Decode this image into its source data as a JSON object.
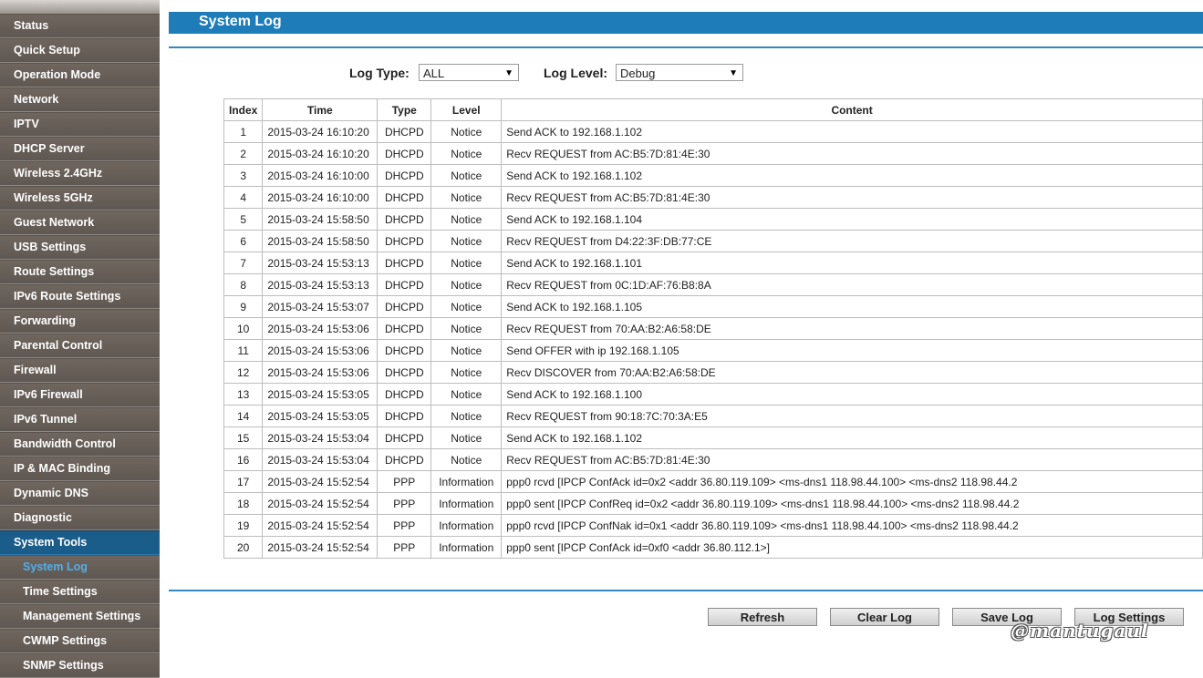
{
  "sidebar": {
    "items": [
      {
        "label": "Status"
      },
      {
        "label": "Quick Setup"
      },
      {
        "label": "Operation Mode"
      },
      {
        "label": "Network"
      },
      {
        "label": "IPTV"
      },
      {
        "label": "DHCP Server"
      },
      {
        "label": "Wireless 2.4GHz"
      },
      {
        "label": "Wireless 5GHz"
      },
      {
        "label": "Guest Network"
      },
      {
        "label": "USB Settings"
      },
      {
        "label": "Route Settings"
      },
      {
        "label": "IPv6 Route Settings"
      },
      {
        "label": "Forwarding"
      },
      {
        "label": "Parental Control"
      },
      {
        "label": "Firewall"
      },
      {
        "label": "IPv6 Firewall"
      },
      {
        "label": "IPv6 Tunnel"
      },
      {
        "label": "Bandwidth Control"
      },
      {
        "label": "IP & MAC Binding"
      },
      {
        "label": "Dynamic DNS"
      },
      {
        "label": "Diagnostic"
      },
      {
        "label": "System Tools"
      },
      {
        "label": "System Log"
      },
      {
        "label": "Time Settings"
      },
      {
        "label": "Management Settings"
      },
      {
        "label": "CWMP Settings"
      },
      {
        "label": "SNMP Settings"
      }
    ]
  },
  "header": {
    "title": "System Log"
  },
  "filters": {
    "log_type_label": "Log Type:",
    "log_type_value": "ALL",
    "log_level_label": "Log Level:",
    "log_level_value": "Debug"
  },
  "table": {
    "headers": {
      "index": "Index",
      "time": "Time",
      "type": "Type",
      "level": "Level",
      "content": "Content"
    },
    "rows": [
      {
        "index": "1",
        "time": "2015-03-24 16:10:20",
        "type": "DHCPD",
        "level": "Notice",
        "content": "Send ACK to 192.168.1.102"
      },
      {
        "index": "2",
        "time": "2015-03-24 16:10:20",
        "type": "DHCPD",
        "level": "Notice",
        "content": "Recv REQUEST from AC:B5:7D:81:4E:30"
      },
      {
        "index": "3",
        "time": "2015-03-24 16:10:00",
        "type": "DHCPD",
        "level": "Notice",
        "content": "Send ACK to 192.168.1.102"
      },
      {
        "index": "4",
        "time": "2015-03-24 16:10:00",
        "type": "DHCPD",
        "level": "Notice",
        "content": "Recv REQUEST from AC:B5:7D:81:4E:30"
      },
      {
        "index": "5",
        "time": "2015-03-24 15:58:50",
        "type": "DHCPD",
        "level": "Notice",
        "content": "Send ACK to 192.168.1.104"
      },
      {
        "index": "6",
        "time": "2015-03-24 15:58:50",
        "type": "DHCPD",
        "level": "Notice",
        "content": "Recv REQUEST from D4:22:3F:DB:77:CE"
      },
      {
        "index": "7",
        "time": "2015-03-24 15:53:13",
        "type": "DHCPD",
        "level": "Notice",
        "content": "Send ACK to 192.168.1.101"
      },
      {
        "index": "8",
        "time": "2015-03-24 15:53:13",
        "type": "DHCPD",
        "level": "Notice",
        "content": "Recv REQUEST from 0C:1D:AF:76:B8:8A"
      },
      {
        "index": "9",
        "time": "2015-03-24 15:53:07",
        "type": "DHCPD",
        "level": "Notice",
        "content": "Send ACK to 192.168.1.105"
      },
      {
        "index": "10",
        "time": "2015-03-24 15:53:06",
        "type": "DHCPD",
        "level": "Notice",
        "content": "Recv REQUEST from 70:AA:B2:A6:58:DE"
      },
      {
        "index": "11",
        "time": "2015-03-24 15:53:06",
        "type": "DHCPD",
        "level": "Notice",
        "content": "Send OFFER with ip 192.168.1.105"
      },
      {
        "index": "12",
        "time": "2015-03-24 15:53:06",
        "type": "DHCPD",
        "level": "Notice",
        "content": "Recv DISCOVER from 70:AA:B2:A6:58:DE"
      },
      {
        "index": "13",
        "time": "2015-03-24 15:53:05",
        "type": "DHCPD",
        "level": "Notice",
        "content": "Send ACK to 192.168.1.100"
      },
      {
        "index": "14",
        "time": "2015-03-24 15:53:05",
        "type": "DHCPD",
        "level": "Notice",
        "content": "Recv REQUEST from 90:18:7C:70:3A:E5"
      },
      {
        "index": "15",
        "time": "2015-03-24 15:53:04",
        "type": "DHCPD",
        "level": "Notice",
        "content": "Send ACK to 192.168.1.102"
      },
      {
        "index": "16",
        "time": "2015-03-24 15:53:04",
        "type": "DHCPD",
        "level": "Notice",
        "content": "Recv REQUEST from AC:B5:7D:81:4E:30"
      },
      {
        "index": "17",
        "time": "2015-03-24 15:52:54",
        "type": "PPP",
        "level": "Information",
        "content": "ppp0 rcvd [IPCP ConfAck id=0x2 <addr 36.80.119.109> <ms-dns1 118.98.44.100> <ms-dns2 118.98.44.2"
      },
      {
        "index": "18",
        "time": "2015-03-24 15:52:54",
        "type": "PPP",
        "level": "Information",
        "content": "ppp0 sent [IPCP ConfReq id=0x2 <addr 36.80.119.109> <ms-dns1 118.98.44.100> <ms-dns2 118.98.44.2"
      },
      {
        "index": "19",
        "time": "2015-03-24 15:52:54",
        "type": "PPP",
        "level": "Information",
        "content": "ppp0 rcvd [IPCP ConfNak id=0x1 <addr 36.80.119.109> <ms-dns1 118.98.44.100> <ms-dns2 118.98.44.2"
      },
      {
        "index": "20",
        "time": "2015-03-24 15:52:54",
        "type": "PPP",
        "level": "Information",
        "content": "ppp0 sent [IPCP ConfAck id=0xf0 <addr 36.80.112.1>]"
      }
    ]
  },
  "buttons": {
    "refresh": "Refresh",
    "clear_log": "Clear Log",
    "save_log": "Save Log",
    "log_settings": "Log Settings"
  },
  "watermark": "@mantugaul",
  "colors": {
    "sidebar_bg": "#6e655f",
    "active_menu": "#1a5c8a",
    "active_submenu_text": "#4fb0ec",
    "header_bar": "#1e7cb8"
  }
}
